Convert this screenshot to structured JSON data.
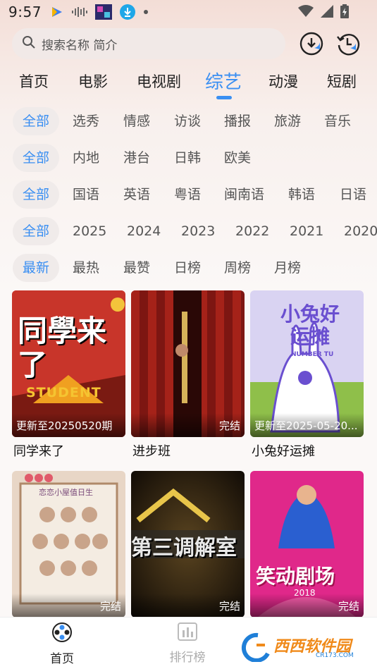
{
  "status_bar": {
    "time": "9:57"
  },
  "search": {
    "placeholder": "搜索名称 简介"
  },
  "category_tabs": [
    {
      "label": "首页"
    },
    {
      "label": "电影"
    },
    {
      "label": "电视剧"
    },
    {
      "label": "综艺",
      "active": true
    },
    {
      "label": "动漫"
    },
    {
      "label": "短剧"
    }
  ],
  "filters": {
    "genre": [
      "全部",
      "选秀",
      "情感",
      "访谈",
      "播报",
      "旅游",
      "音乐"
    ],
    "region": [
      "全部",
      "内地",
      "港台",
      "日韩",
      "欧美"
    ],
    "language": [
      "全部",
      "国语",
      "英语",
      "粤语",
      "闽南语",
      "韩语",
      "日语"
    ],
    "year": [
      "全部",
      "2025",
      "2024",
      "2023",
      "2022",
      "2021",
      "2020"
    ],
    "sort": [
      "最新",
      "最热",
      "最赞",
      "日榜",
      "周榜",
      "月榜"
    ]
  },
  "cards": [
    {
      "title": "同学来了",
      "badge": "更新至20250520期",
      "poster_text": "同學来了",
      "poster_sub": "STUDENT"
    },
    {
      "title": "进步班",
      "badge": "完结"
    },
    {
      "title": "小兔好运摊",
      "badge": "更新至2025-05-20...",
      "poster_text": "小兔好运摊",
      "poster_sub": "NUMBER TU"
    },
    {
      "title": "",
      "badge": "完结",
      "poster_text": "恋恋小屋值日生"
    },
    {
      "title": "",
      "badge": "完结",
      "poster_text": "第三调解室"
    },
    {
      "title": "",
      "badge": "完结",
      "poster_text": "笑动剧场",
      "poster_sub": "2018"
    }
  ],
  "bottom_nav": [
    {
      "label": "首页",
      "icon": "home-reel-icon",
      "active": true
    },
    {
      "label": "排行榜",
      "icon": "rank-icon"
    }
  ],
  "watermark": {
    "text": "西西软件园",
    "sub": "CR173.COM"
  },
  "colors": {
    "accent": "#3a8ff2",
    "text": "#222222",
    "muted": "#555555"
  }
}
